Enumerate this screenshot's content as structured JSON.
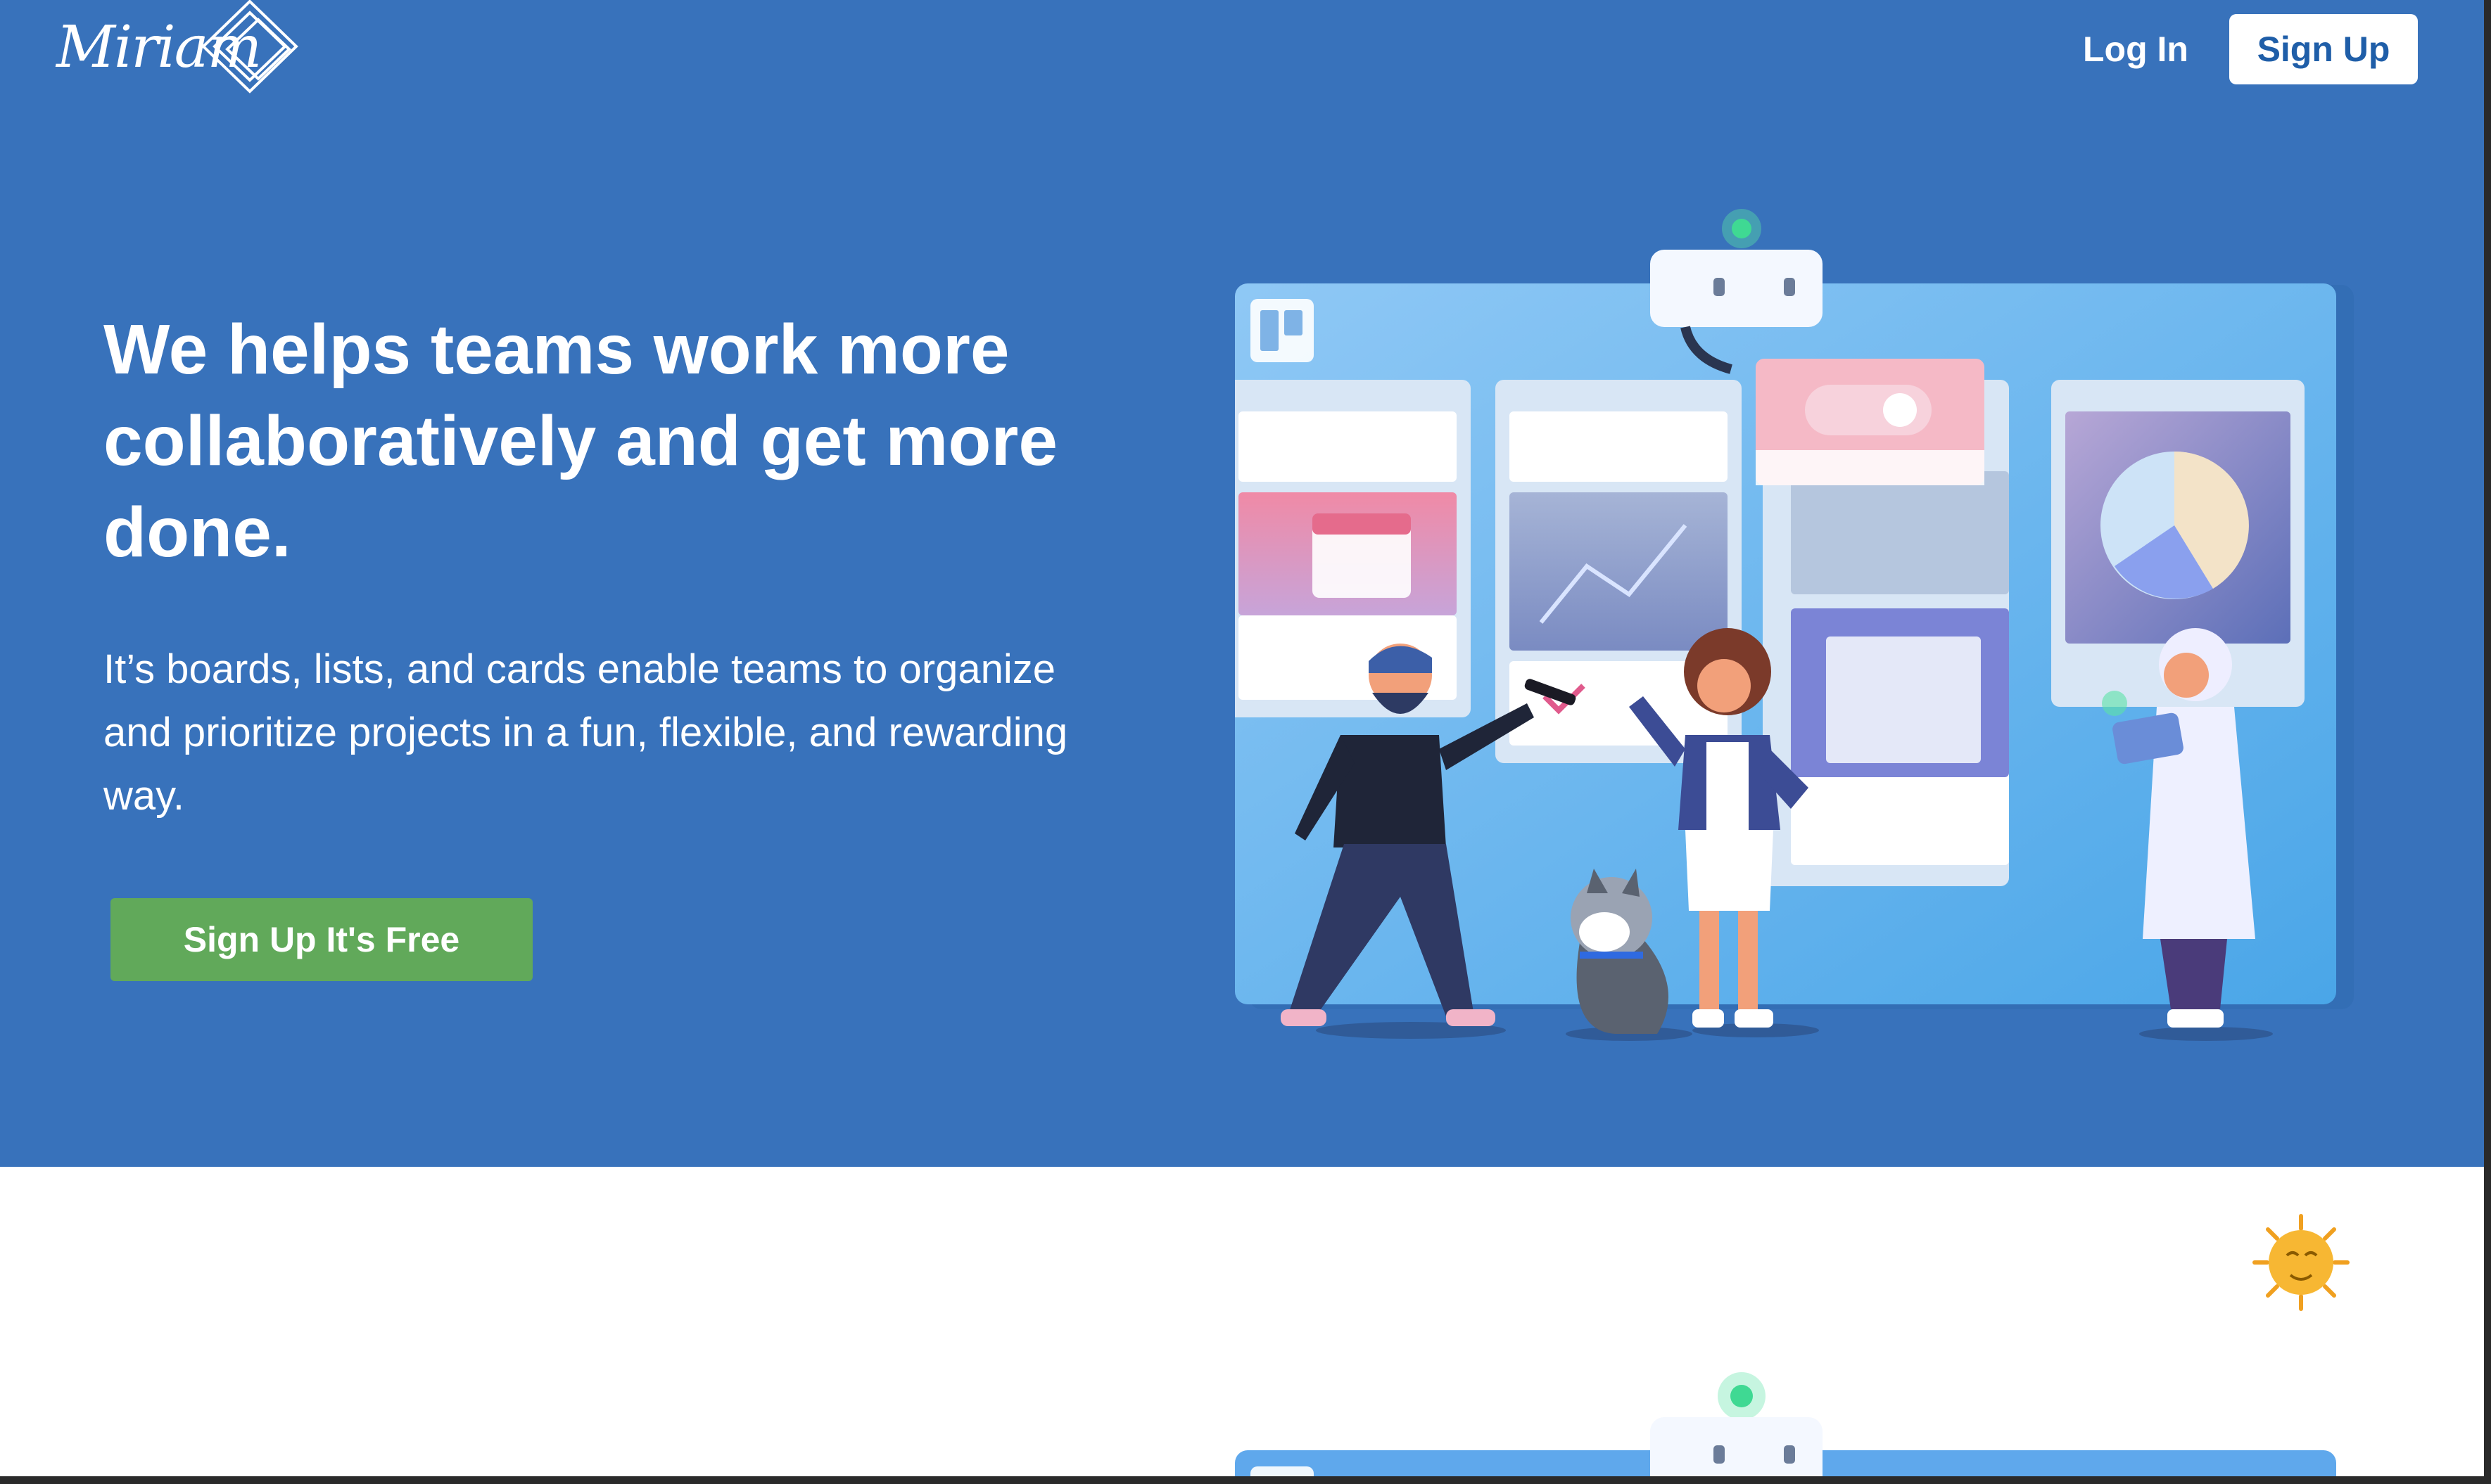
{
  "brand": {
    "name": "Miriam"
  },
  "nav": {
    "login_label": "Log In",
    "signup_label": "Sign Up"
  },
  "hero": {
    "headline": "We helps teams work more collaboratively and get more done.",
    "subtext": "It’s boards, lists, and cards enable teams to organize and prioritize projects in a fun, flexible, and rewarding way.",
    "cta_label": "Sign Up It's Free",
    "illustration_icon": "team-collaboration-board-illustration"
  },
  "theme_toggle": {
    "icon": "sun-face-icon"
  },
  "colors": {
    "hero_background": "#3872bb",
    "cta_green": "#61a95a",
    "signup_text": "#1f5ea8",
    "page_background": "#ffffff"
  }
}
